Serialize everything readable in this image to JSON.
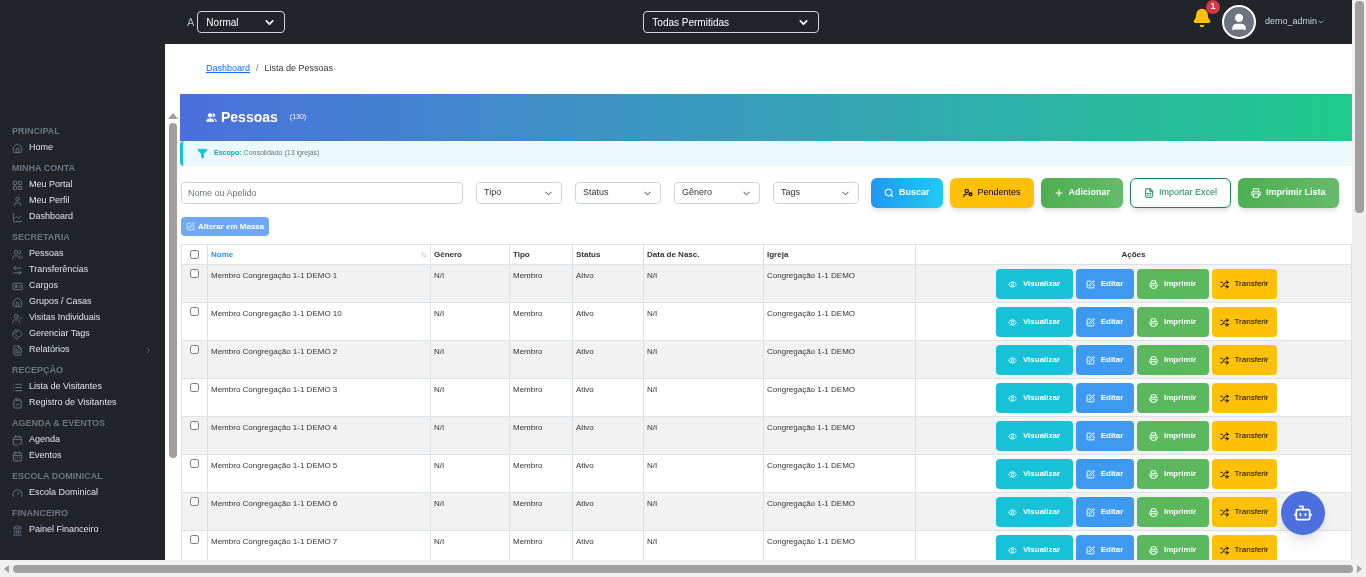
{
  "topbar": {
    "font_label": "A",
    "font_select": "Normal",
    "scope_select": "Todas Permitidas",
    "notifications": "1",
    "user": "demo_admin"
  },
  "sidebar": [
    {
      "title": "PRINCIPAL",
      "items": [
        {
          "label": "Home",
          "expandable": false
        }
      ]
    },
    {
      "title": "MINHA CONTA",
      "items": [
        {
          "label": "Meu Portal",
          "expandable": false
        },
        {
          "label": "Meu Perfil",
          "expandable": false
        },
        {
          "label": "Dashboard",
          "expandable": false
        }
      ]
    },
    {
      "title": "SECRETARIA",
      "items": [
        {
          "label": "Pessoas",
          "expandable": false
        },
        {
          "label": "Transferências",
          "expandable": false
        },
        {
          "label": "Cargos",
          "expandable": false
        },
        {
          "label": "Grupos / Casas",
          "expandable": false
        },
        {
          "label": "Visitas Individuais",
          "expandable": false
        },
        {
          "label": "Gerenciar Tags",
          "expandable": false
        },
        {
          "label": "Relatórios",
          "expandable": true
        }
      ]
    },
    {
      "title": "RECEPÇÃO",
      "items": [
        {
          "label": "Lista de Visitantes",
          "expandable": false
        },
        {
          "label": "Registro de Visitantes",
          "expandable": false
        }
      ]
    },
    {
      "title": "AGENDA & EVENTOS",
      "items": [
        {
          "label": "Agenda",
          "expandable": false
        },
        {
          "label": "Eventos",
          "expandable": false
        }
      ]
    },
    {
      "title": "ESCOLA DOMINICAL",
      "items": [
        {
          "label": "Escola Dominical",
          "expandable": false
        }
      ]
    },
    {
      "title": "FINANCEIRO",
      "items": [
        {
          "label": "Painel Financeiro",
          "expandable": false
        }
      ]
    }
  ],
  "breadcrumb": {
    "link": "Dashboard",
    "separator": "/",
    "current": "Lista de Pessoas"
  },
  "header": {
    "title": "Pessoas",
    "count": "(130)"
  },
  "scope": {
    "label": "Escopo:",
    "value": "Consolidado (13 igrejas)"
  },
  "filters": {
    "search_placeholder": "Nome ou Apelido",
    "selects": [
      "Tipo",
      "Status",
      "Gênero",
      "Tags"
    ]
  },
  "toolbar": [
    {
      "kind": "search",
      "label": "Buscar"
    },
    {
      "kind": "pending",
      "label": "Pendentes"
    },
    {
      "kind": "add",
      "label": "Adicionar"
    },
    {
      "kind": "import",
      "label": "Importar Excel"
    },
    {
      "kind": "print",
      "label": "Imprimir Lista"
    }
  ],
  "bulk_button": "Alterar em Massa",
  "table": {
    "all_checked": false,
    "columns": [
      "Nome",
      "Gênero",
      "Tipo",
      "Status",
      "Data de Nasc.",
      "Igreja",
      "Ações"
    ],
    "rows": [
      {
        "checked": false,
        "cells": [
          "Membro Congregação 1-1 DEMO 1",
          "N/I",
          "Membro",
          "Ativo",
          "N/I",
          "Congregação 1-1 DEMO"
        ],
        "actions": [
          {
            "kind": "view",
            "label": "Visualizar"
          },
          {
            "kind": "edit",
            "label": "Editar"
          },
          {
            "kind": "print",
            "label": "Imprimir"
          },
          {
            "kind": "transfer",
            "label": "Transferir"
          }
        ]
      },
      {
        "checked": false,
        "cells": [
          "Membro Congregação 1-1 DEMO 10",
          "N/I",
          "Membro",
          "Ativo",
          "N/I",
          "Congregação 1-1 DEMO"
        ],
        "actions": [
          {
            "kind": "view",
            "label": "Visualizar"
          },
          {
            "kind": "edit",
            "label": "Editar"
          },
          {
            "kind": "print",
            "label": "Imprimir"
          },
          {
            "kind": "transfer",
            "label": "Transferir"
          }
        ]
      },
      {
        "checked": false,
        "cells": [
          "Membro Congregação 1-1 DEMO 2",
          "N/I",
          "Membro",
          "Ativo",
          "N/I",
          "Congregação 1-1 DEMO"
        ],
        "actions": [
          {
            "kind": "view",
            "label": "Visualizar"
          },
          {
            "kind": "edit",
            "label": "Editar"
          },
          {
            "kind": "print",
            "label": "Imprimir"
          },
          {
            "kind": "transfer",
            "label": "Transferir"
          }
        ]
      },
      {
        "checked": false,
        "cells": [
          "Membro Congregação 1-1 DEMO 3",
          "N/I",
          "Membro",
          "Ativo",
          "N/I",
          "Congregação 1-1 DEMO"
        ],
        "actions": [
          {
            "kind": "view",
            "label": "Visualizar"
          },
          {
            "kind": "edit",
            "label": "Editar"
          },
          {
            "kind": "print",
            "label": "Imprimir"
          },
          {
            "kind": "transfer",
            "label": "Transferir"
          }
        ]
      },
      {
        "checked": false,
        "cells": [
          "Membro Congregação 1-1 DEMO 4",
          "N/I",
          "Membro",
          "Ativo",
          "N/I",
          "Congregação 1-1 DEMO"
        ],
        "actions": [
          {
            "kind": "view",
            "label": "Visualizar"
          },
          {
            "kind": "edit",
            "label": "Editar"
          },
          {
            "kind": "print",
            "label": "Imprimir"
          },
          {
            "kind": "transfer",
            "label": "Transferir"
          }
        ]
      },
      {
        "checked": false,
        "cells": [
          "Membro Congregação 1-1 DEMO 5",
          "N/I",
          "Membro",
          "Ativo",
          "N/I",
          "Congregação 1-1 DEMO"
        ],
        "actions": [
          {
            "kind": "view",
            "label": "Visualizar"
          },
          {
            "kind": "edit",
            "label": "Editar"
          },
          {
            "kind": "print",
            "label": "Imprimir"
          },
          {
            "kind": "transfer",
            "label": "Transferir"
          }
        ]
      },
      {
        "checked": false,
        "cells": [
          "Membro Congregação 1-1 DEMO 6",
          "N/I",
          "Membro",
          "Ativo",
          "N/I",
          "Congregação 1-1 DEMO"
        ],
        "actions": [
          {
            "kind": "view",
            "label": "Visualizar"
          },
          {
            "kind": "edit",
            "label": "Editar"
          },
          {
            "kind": "print",
            "label": "Imprimir"
          },
          {
            "kind": "transfer",
            "label": "Transferir"
          }
        ]
      },
      {
        "checked": false,
        "cells": [
          "Membro Congregação 1-1 DEMO 7",
          "N/I",
          "Membro",
          "Ativo",
          "N/I",
          "Congregação 1-1 DEMO"
        ],
        "actions": [
          {
            "kind": "view",
            "label": "Visualizar"
          },
          {
            "kind": "edit",
            "label": "Editar"
          },
          {
            "kind": "print",
            "label": "Imprimir"
          },
          {
            "kind": "transfer",
            "label": "Transferir"
          }
        ]
      }
    ]
  }
}
